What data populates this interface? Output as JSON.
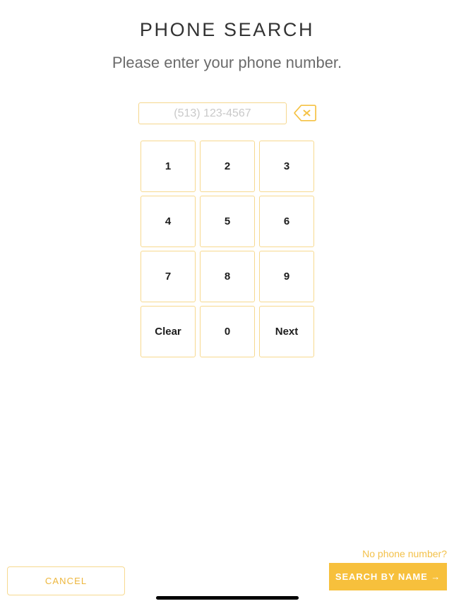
{
  "header": {
    "title": "PHONE SEARCH",
    "subtitle": "Please enter your phone number."
  },
  "phone_field": {
    "placeholder": "(513) 123-4567",
    "value": "",
    "backspace_icon": "backspace-x-icon"
  },
  "keypad": {
    "keys": [
      {
        "label": "1",
        "name": "key-1"
      },
      {
        "label": "2",
        "name": "key-2"
      },
      {
        "label": "3",
        "name": "key-3"
      },
      {
        "label": "4",
        "name": "key-4"
      },
      {
        "label": "5",
        "name": "key-5"
      },
      {
        "label": "6",
        "name": "key-6"
      },
      {
        "label": "7",
        "name": "key-7"
      },
      {
        "label": "8",
        "name": "key-8"
      },
      {
        "label": "9",
        "name": "key-9"
      },
      {
        "label": "Clear",
        "name": "key-clear"
      },
      {
        "label": "0",
        "name": "key-0"
      },
      {
        "label": "Next",
        "name": "key-next"
      }
    ]
  },
  "footer": {
    "no_phone_link": "No phone number?",
    "cancel_label": "CANCEL",
    "search_by_name_label": "SEARCH BY NAME →"
  },
  "colors": {
    "accent_fill": "#f7c03c",
    "accent_border": "#f7d98f",
    "accent_text": "#edb63c",
    "title_text": "#333333",
    "subtitle_text": "#6b6b6b",
    "placeholder_text": "#c9c9c9",
    "background": "#ffffff"
  }
}
